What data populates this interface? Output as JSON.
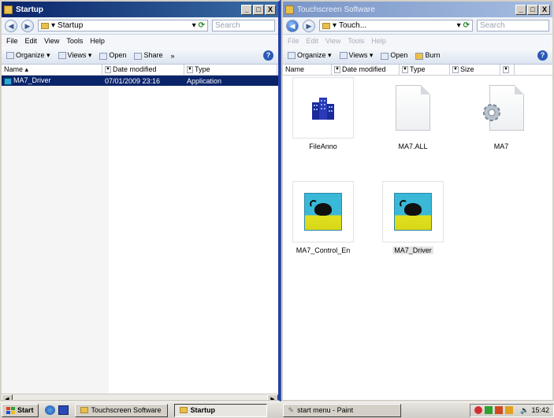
{
  "left_window": {
    "title": "Startup",
    "address": "Startup",
    "search_placeholder": "Search",
    "menu": [
      "File",
      "Edit",
      "View",
      "Tools",
      "Help"
    ],
    "toolbar": {
      "organize": "Organize ▾",
      "views": "Views ▾",
      "open": "Open",
      "share": "Share",
      "more": "»"
    },
    "columns": {
      "name": "Name",
      "date": "Date modified",
      "type": "Type"
    },
    "files": [
      {
        "name": "MA7_Driver",
        "date": "07/01/2009 23:16",
        "type": "Application"
      }
    ],
    "controls": {
      "minimize": "_",
      "maximize": "□",
      "close": "X"
    }
  },
  "right_window": {
    "title": "Touchscreen Software",
    "address": "Touch...",
    "search_placeholder": "Search",
    "menu": [
      "File",
      "Edit",
      "View",
      "Tools",
      "Help"
    ],
    "toolbar": {
      "organize": "Organize ▾",
      "views": "Views ▾",
      "open": "Open",
      "burn": "Burn"
    },
    "columns": {
      "name": "Name",
      "date": "Date modified",
      "type": "Type",
      "size": "Size"
    },
    "icons": [
      {
        "label": "FileAnno",
        "kind": "app-buildings"
      },
      {
        "label": "MA7.ALL",
        "kind": "document"
      },
      {
        "label": "MA7",
        "kind": "gear-document"
      },
      {
        "label": "MA7_Control_En",
        "kind": "mouse-app"
      },
      {
        "label": "MA7_Driver",
        "kind": "mouse-app"
      }
    ],
    "controls": {
      "minimize": "_",
      "maximize": "□",
      "close": "X"
    }
  },
  "taskbar": {
    "start_label": "Start",
    "buttons": [
      "Touchscreen Software",
      "Startup",
      "start menu - Paint"
    ],
    "active_button": "Startup",
    "clock": "15:42"
  },
  "colors": {
    "selection": "#0a246a",
    "divider": "#2a3ea8",
    "accent": "#3ab8d8"
  }
}
